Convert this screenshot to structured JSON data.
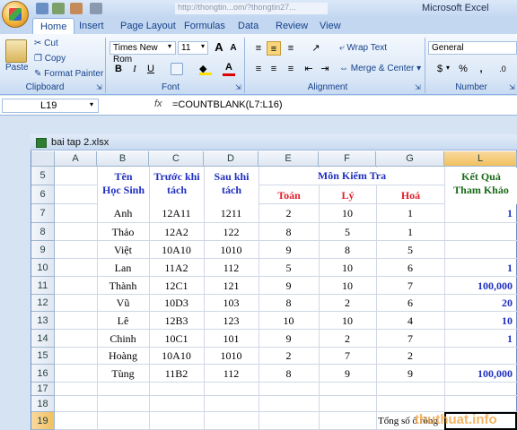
{
  "window": {
    "title_url": "http://thongtin...om/?thongtin27...",
    "app_title": "Microsoft Excel"
  },
  "tabs": [
    "Home",
    "Insert",
    "Page Layout",
    "Formulas",
    "Data",
    "Review",
    "View"
  ],
  "ribbon": {
    "clipboard": {
      "paste": "Paste",
      "cut": "Cut",
      "copy": "Copy",
      "format_painter": "Format Painter",
      "label": "Clipboard"
    },
    "font": {
      "name": "Times New Rom",
      "size": "11",
      "label": "Font",
      "bold": "B",
      "italic": "I",
      "underline": "U"
    },
    "alignment": {
      "wrap_text": "Wrap Text",
      "merge_center": "Merge & Center",
      "label": "Alignment"
    },
    "number": {
      "format": "General",
      "currency": "$",
      "percent": "%",
      "comma": ",",
      "label": "Number"
    }
  },
  "formula_bar": {
    "cell_ref": "L19",
    "fx": "fx",
    "formula": "=COUNTBLANK(L7:L16)"
  },
  "workbook": {
    "name": "bai tap 2.xlsx"
  },
  "columns": [
    "A",
    "B",
    "C",
    "D",
    "E",
    "F",
    "G",
    "L"
  ],
  "selected_column": "L",
  "row_numbers": [
    "5",
    "6",
    "7",
    "8",
    "9",
    "10",
    "11",
    "12",
    "13",
    "14",
    "15",
    "16",
    "17",
    "18",
    "19"
  ],
  "selected_row": "19",
  "headers": {
    "ten_hoc_sinh": [
      "Tên",
      "Học Sinh"
    ],
    "truoc_khi_tach": [
      "Trước khi",
      "tách"
    ],
    "sau_khi_tach": [
      "Sau khi",
      "tách"
    ],
    "mon_kiem_tra": "Môn Kiểm Tra",
    "toan": "Toán",
    "ly": "Lý",
    "hoa": "Hoá",
    "ket_qua": [
      "Kết Quả",
      "Tham Khảo"
    ]
  },
  "rows": [
    {
      "name": "Anh",
      "before": "12A11",
      "after": "1211",
      "toan": "2",
      "ly": "10",
      "hoa": "1",
      "result": "1"
    },
    {
      "name": "Thảo",
      "before": "12A2",
      "after": "122",
      "toan": "8",
      "ly": "5",
      "hoa": "1",
      "result": ""
    },
    {
      "name": "Việt",
      "before": "10A10",
      "after": "1010",
      "toan": "9",
      "ly": "8",
      "hoa": "5",
      "result": ""
    },
    {
      "name": "Lan",
      "before": "11A2",
      "after": "112",
      "toan": "5",
      "ly": "10",
      "hoa": "6",
      "result": "1"
    },
    {
      "name": "Thành",
      "before": "12C1",
      "after": "121",
      "toan": "9",
      "ly": "10",
      "hoa": "7",
      "result": "100,000"
    },
    {
      "name": "Vũ",
      "before": "10D3",
      "after": "103",
      "toan": "8",
      "ly": "2",
      "hoa": "6",
      "result": "20"
    },
    {
      "name": "Lê",
      "before": "12B3",
      "after": "123",
      "toan": "10",
      "ly": "10",
      "hoa": "4",
      "result": "10"
    },
    {
      "name": "Chinh",
      "before": "10C1",
      "after": "101",
      "toan": "9",
      "ly": "2",
      "hoa": "7",
      "result": "1"
    },
    {
      "name": "Hoàng",
      "before": "10A10",
      "after": "1010",
      "toan": "2",
      "ly": "7",
      "hoa": "2",
      "result": ""
    },
    {
      "name": "Tùng",
      "before": "11B2",
      "after": "112",
      "toan": "8",
      "ly": "9",
      "hoa": "9",
      "result": "100,000"
    }
  ],
  "footer_label": "Tổng số ô rỗng",
  "watermark": "thuthuat.info",
  "colors": {
    "header_blue": "#1f2fbf",
    "header_red": "#e0202a",
    "header_green": "#1a6b1a",
    "selection": "#f1c15f"
  }
}
